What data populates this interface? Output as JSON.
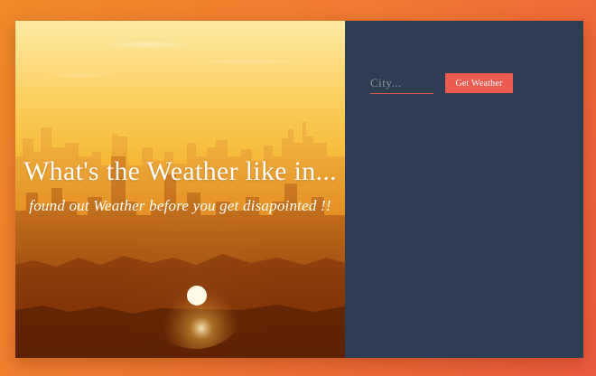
{
  "hero": {
    "headline": "What's the Weather like in...",
    "tagline": "found out Weather before you get disapointed !!"
  },
  "form": {
    "city_placeholder": "City...",
    "city_value": "",
    "submit_label": "Get Weather"
  },
  "colors": {
    "page_background": "#ef7a30",
    "panel_background": "#2d3e52",
    "accent": "#ec5a50"
  }
}
